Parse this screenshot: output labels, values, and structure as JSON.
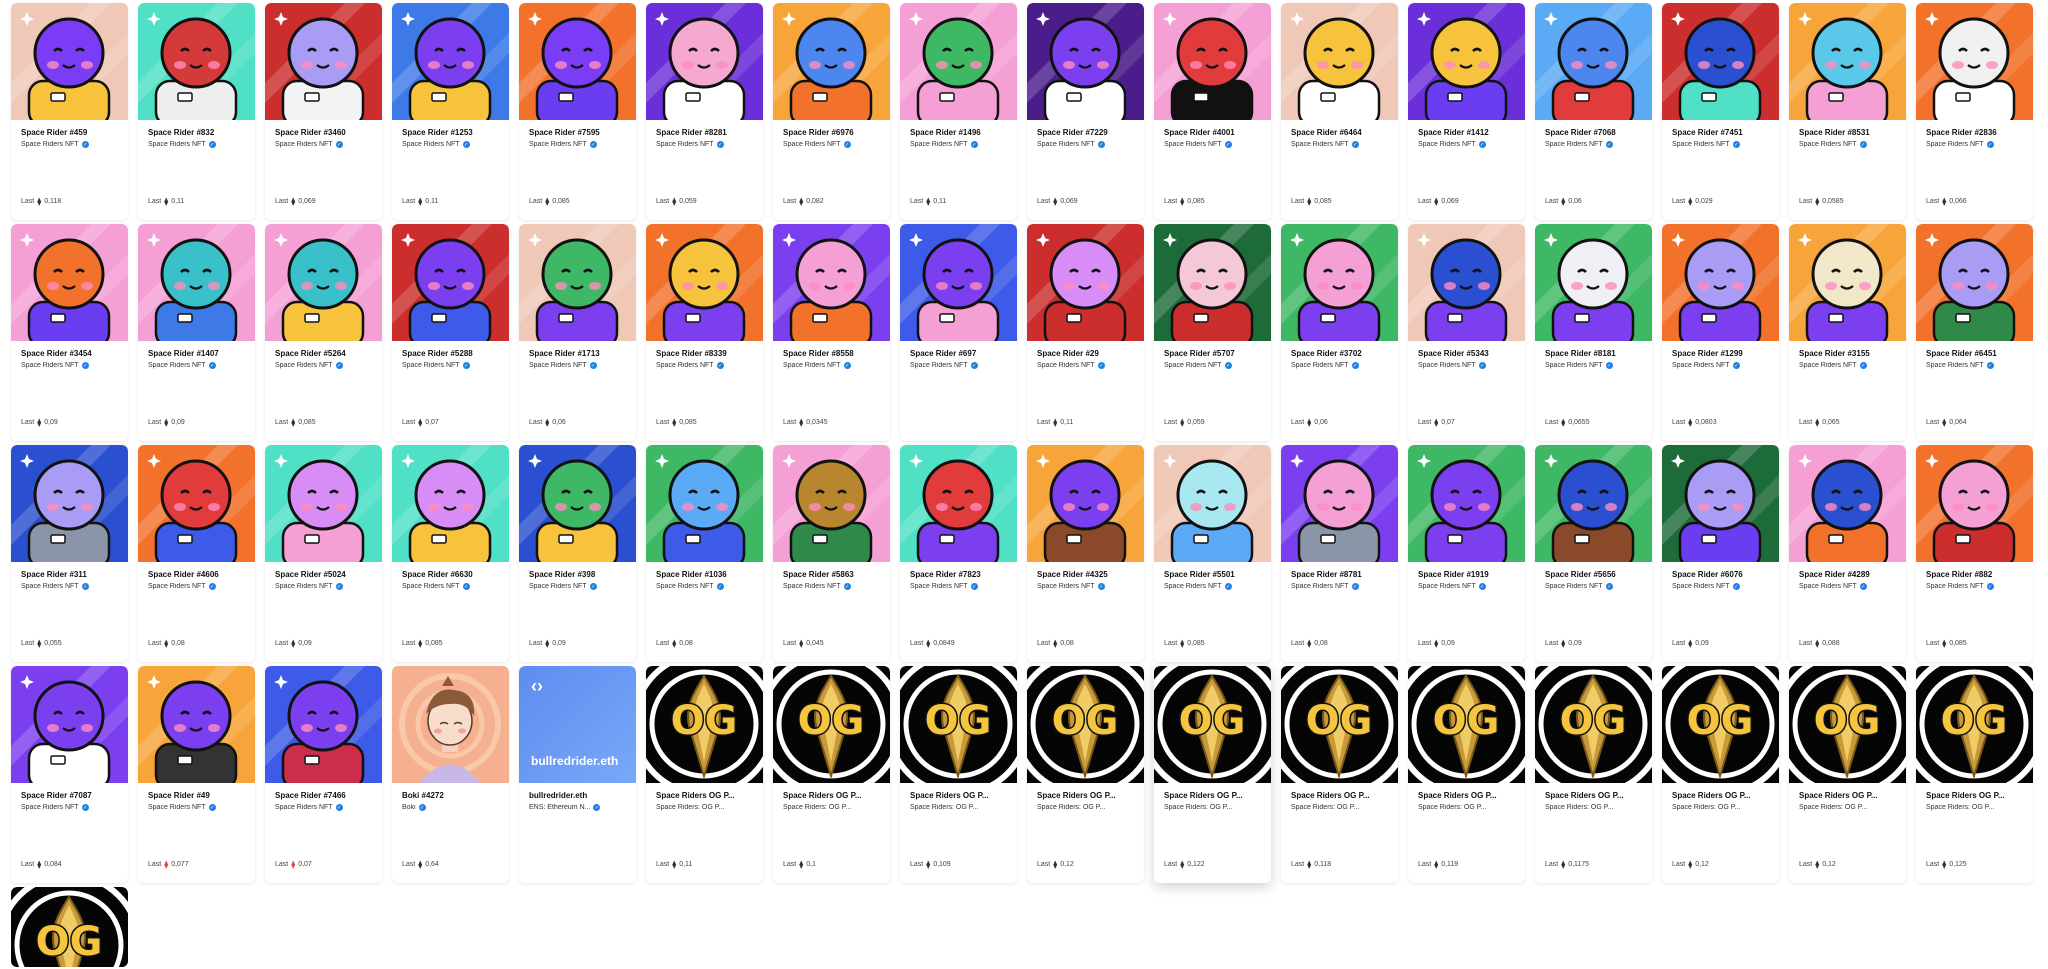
{
  "last_label": "Last",
  "eth_symbol": "⧫",
  "verified_symbol": "✓",
  "rows": [
    [
      {
        "name": "Space Rider #459",
        "collection": "Space Riders NFT",
        "verified": true,
        "price": "0,118",
        "bg": "#f0c8b8",
        "face": "#7a3df5",
        "suit": "#f7c33d",
        "icon": "rider-avatar"
      },
      {
        "name": "Space Rider #832",
        "collection": "Space Riders NFT",
        "verified": true,
        "price": "0,11",
        "bg": "#4fe0c5",
        "face": "#d43a3a",
        "suit": "#eeeeee",
        "icon": "rider-avatar"
      },
      {
        "name": "Space Rider #3460",
        "collection": "Space Riders NFT",
        "verified": true,
        "price": "0,069",
        "bg": "#cc2d2d",
        "face": "#a89cf5",
        "suit": "#f3f3f3",
        "icon": "rider-avatar"
      },
      {
        "name": "Space Rider #1253",
        "collection": "Space Riders NFT",
        "verified": true,
        "price": "0,11",
        "bg": "#3d7ae8",
        "face": "#7b3ff0",
        "suit": "#f7c33d",
        "icon": "rider-avatar"
      },
      {
        "name": "Space Rider #7595",
        "collection": "Space Riders NFT",
        "verified": true,
        "price": "0,085",
        "bg": "#f2722c",
        "face": "#7a3df5",
        "suit": "#6b3df0",
        "icon": "rider-avatar"
      },
      {
        "name": "Space Rider #8281",
        "collection": "Space Riders NFT",
        "verified": true,
        "price": "0,059",
        "bg": "#6a2fd8",
        "face": "#f5a8d0",
        "suit": "#ffffff",
        "icon": "rider-avatar"
      },
      {
        "name": "Space Rider #6976",
        "collection": "Space Riders NFT",
        "verified": true,
        "price": "0,082",
        "bg": "#f7a53a",
        "face": "#4e86f0",
        "suit": "#f2722c",
        "icon": "rider-avatar"
      },
      {
        "name": "Space Rider #1496",
        "collection": "Space Riders NFT",
        "verified": true,
        "price": "0,11",
        "bg": "#f5a0d5",
        "face": "#3fb866",
        "suit": "#f5a0d5",
        "icon": "rider-avatar"
      },
      {
        "name": "Space Rider #7229",
        "collection": "Space Riders NFT",
        "verified": true,
        "price": "0,069",
        "bg": "#4a1d8a",
        "face": "#7b3ff0",
        "suit": "#ffffff",
        "icon": "rider-avatar"
      },
      {
        "name": "Space Rider #4001",
        "collection": "Space Riders NFT",
        "verified": true,
        "price": "0,085",
        "bg": "#f5a0d5",
        "face": "#e23b3b",
        "suit": "#111111",
        "icon": "rider-avatar"
      },
      {
        "name": "Space Rider #6464",
        "collection": "Space Riders NFT",
        "verified": true,
        "price": "0,085",
        "bg": "#f0c8b8",
        "face": "#f7c33d",
        "suit": "#ffffff",
        "icon": "rider-avatar"
      },
      {
        "name": "Space Rider #1412",
        "collection": "Space Riders NFT",
        "verified": true,
        "price": "0,069",
        "bg": "#6a2fd8",
        "face": "#f7c33d",
        "suit": "#6b3df0",
        "icon": "rider-avatar"
      },
      {
        "name": "Space Rider #7068",
        "collection": "Space Riders NFT",
        "verified": true,
        "price": "0,06",
        "bg": "#5aaaf5",
        "face": "#4e86f0",
        "suit": "#e23b3b",
        "icon": "rider-avatar"
      },
      {
        "name": "Space Rider #7451",
        "collection": "Space Riders NFT",
        "verified": true,
        "price": "0,029",
        "bg": "#cc2d2d",
        "face": "#2a4fd0",
        "suit": "#4fe0c5",
        "icon": "rider-avatar"
      },
      {
        "name": "Space Rider #8531",
        "collection": "Space Riders NFT",
        "verified": true,
        "price": "0,0585",
        "bg": "#f7a53a",
        "face": "#5ac8e8",
        "suit": "#f5a0d5",
        "icon": "rider-avatar"
      },
      {
        "name": "Space Rider #2836",
        "collection": "Space Riders NFT",
        "verified": true,
        "price": "0,066",
        "bg": "#f2722c",
        "face": "#f0f0f0",
        "suit": "#ffffff",
        "icon": "rider-avatar"
      }
    ],
    [
      {
        "name": "Space Rider #3454",
        "collection": "Space Riders NFT",
        "verified": true,
        "price": "0,09",
        "bg": "#f5a0d5",
        "face": "#f2722c",
        "suit": "#6b3df0",
        "icon": "rider-avatar"
      },
      {
        "name": "Space Rider #1407",
        "collection": "Space Riders NFT",
        "verified": true,
        "price": "0,09",
        "bg": "#f5a0d5",
        "face": "#3ac0c8",
        "suit": "#3d7ae8",
        "icon": "rider-avatar"
      },
      {
        "name": "Space Rider #5264",
        "collection": "Space Riders NFT",
        "verified": true,
        "price": "0,085",
        "bg": "#f5a0d5",
        "face": "#3ac0c8",
        "suit": "#f7c33d",
        "icon": "rider-avatar"
      },
      {
        "name": "Space Rider #5288",
        "collection": "Space Riders NFT",
        "verified": true,
        "price": "0,07",
        "bg": "#cc2d2d",
        "face": "#7b3ff0",
        "suit": "#3d5ae8",
        "icon": "rider-avatar"
      },
      {
        "name": "Space Rider #1713",
        "collection": "Space Riders NFT",
        "verified": true,
        "price": "0,06",
        "bg": "#f0c8b8",
        "face": "#3fb866",
        "suit": "#7b3ff0",
        "icon": "rider-avatar"
      },
      {
        "name": "Space Rider #8339",
        "collection": "Space Riders NFT",
        "verified": true,
        "price": "0,085",
        "bg": "#f2722c",
        "face": "#f7c33d",
        "suit": "#7b3ff0",
        "icon": "rider-avatar"
      },
      {
        "name": "Space Rider #8558",
        "collection": "Space Riders NFT",
        "verified": true,
        "price": "0,0345",
        "bg": "#7b3ff0",
        "face": "#f5a0d5",
        "suit": "#f2722c",
        "icon": "rider-avatar"
      },
      {
        "name": "Space Rider #697",
        "collection": "Space Riders NFT",
        "verified": true,
        "price": "",
        "bg": "#3d5ae8",
        "face": "#7b3ff0",
        "suit": "#f5a0d5",
        "icon": "rider-avatar"
      },
      {
        "name": "Space Rider #29",
        "collection": "Space Riders NFT",
        "verified": true,
        "price": "0,11",
        "bg": "#cc2d2d",
        "face": "#d88cf5",
        "suit": "#cc2d2d",
        "icon": "rider-avatar"
      },
      {
        "name": "Space Rider #5707",
        "collection": "Space Riders NFT",
        "verified": true,
        "price": "0,059",
        "bg": "#1e6b3a",
        "face": "#f5c8d8",
        "suit": "#cc2d2d",
        "icon": "rider-avatar"
      },
      {
        "name": "Space Rider #3702",
        "collection": "Space Riders NFT",
        "verified": true,
        "price": "0,06",
        "bg": "#3fb866",
        "face": "#f5a0d5",
        "suit": "#7b3ff0",
        "icon": "rider-avatar"
      },
      {
        "name": "Space Rider #5343",
        "collection": "Space Riders NFT",
        "verified": true,
        "price": "0,07",
        "bg": "#f0c8b8",
        "face": "#2a4fd0",
        "suit": "#7b3ff0",
        "icon": "rider-avatar"
      },
      {
        "name": "Space Rider #8181",
        "collection": "Space Riders NFT",
        "verified": true,
        "price": "0,0655",
        "bg": "#3fb866",
        "face": "#eef0f5",
        "suit": "#7b3ff0",
        "icon": "rider-avatar"
      },
      {
        "name": "Space Rider #1299",
        "collection": "Space Riders NFT",
        "verified": true,
        "price": "0,0803",
        "bg": "#f2722c",
        "face": "#a89cf5",
        "suit": "#7b3ff0",
        "icon": "rider-avatar"
      },
      {
        "name": "Space Rider #3155",
        "collection": "Space Riders NFT",
        "verified": true,
        "price": "0,065",
        "bg": "#f7a53a",
        "face": "#f0e8c8",
        "suit": "#7b3ff0",
        "icon": "rider-avatar"
      },
      {
        "name": "Space Rider #6451",
        "collection": "Space Riders NFT",
        "verified": true,
        "price": "0,064",
        "bg": "#f2722c",
        "face": "#a89cf5",
        "suit": "#2f8a4a",
        "icon": "rider-avatar"
      }
    ],
    [
      {
        "name": "Space Rider #311",
        "collection": "Space Riders NFT",
        "verified": true,
        "price": "0,055",
        "bg": "#2a4fd0",
        "face": "#a89cf5",
        "suit": "#8a96a8",
        "icon": "rider-avatar"
      },
      {
        "name": "Space Rider #4606",
        "collection": "Space Riders NFT",
        "verified": true,
        "price": "0,08",
        "bg": "#f2722c",
        "face": "#e23b3b",
        "suit": "#3d5ae8",
        "icon": "rider-avatar"
      },
      {
        "name": "Space Rider #5024",
        "collection": "Space Riders NFT",
        "verified": true,
        "price": "0,09",
        "bg": "#4fe0c5",
        "face": "#d88cf5",
        "suit": "#f5a0d5",
        "icon": "rider-avatar"
      },
      {
        "name": "Space Rider #6630",
        "collection": "Space Riders NFT",
        "verified": true,
        "price": "0,085",
        "bg": "#4fe0c5",
        "face": "#d88cf5",
        "suit": "#f7c33d",
        "icon": "rider-avatar"
      },
      {
        "name": "Space Rider #398",
        "collection": "Space Riders NFT",
        "verified": true,
        "price": "0,09",
        "bg": "#2a4fd0",
        "face": "#3fb866",
        "suit": "#f7c33d",
        "icon": "rider-avatar"
      },
      {
        "name": "Space Rider #1036",
        "collection": "Space Riders NFT",
        "verified": true,
        "price": "0,08",
        "bg": "#3fb866",
        "face": "#5aaaf5",
        "suit": "#3d5ae8",
        "icon": "rider-avatar"
      },
      {
        "name": "Space Rider #5863",
        "collection": "Space Riders NFT",
        "verified": true,
        "price": "0,045",
        "bg": "#f5a0d5",
        "face": "#b8862e",
        "suit": "#2f8a4a",
        "icon": "rider-avatar"
      },
      {
        "name": "Space Rider #7823",
        "collection": "Space Riders NFT",
        "verified": true,
        "price": "0,0849",
        "bg": "#4fe0c5",
        "face": "#e23b3b",
        "suit": "#7b3ff0",
        "icon": "rider-avatar"
      },
      {
        "name": "Space Rider #4325",
        "collection": "Space Riders NFT",
        "verified": true,
        "price": "0,08",
        "bg": "#f7a53a",
        "face": "#7b3ff0",
        "suit": "#8a4a2a",
        "icon": "rider-avatar"
      },
      {
        "name": "Space Rider #5501",
        "collection": "Space Riders NFT",
        "verified": true,
        "price": "0,085",
        "bg": "#f0c8b8",
        "face": "#a8e8f0",
        "suit": "#5aaaf5",
        "icon": "rider-avatar"
      },
      {
        "name": "Space Rider #8781",
        "collection": "Space Riders NFT",
        "verified": true,
        "price": "0,08",
        "bg": "#7b3ff0",
        "face": "#f5a0d5",
        "suit": "#8a96a8",
        "icon": "rider-avatar"
      },
      {
        "name": "Space Rider #1919",
        "collection": "Space Riders NFT",
        "verified": true,
        "price": "0,09",
        "bg": "#3fb866",
        "face": "#7b3ff0",
        "suit": "#7b3ff0",
        "icon": "rider-avatar"
      },
      {
        "name": "Space Rider #5656",
        "collection": "Space Riders NFT",
        "verified": true,
        "price": "0,09",
        "bg": "#3fb866",
        "face": "#2a4fd0",
        "suit": "#8a4a2a",
        "icon": "rider-avatar"
      },
      {
        "name": "Space Rider #6076",
        "collection": "Space Riders NFT",
        "verified": true,
        "price": "0,09",
        "bg": "#1e6b3a",
        "face": "#a89cf5",
        "suit": "#6b3df0",
        "icon": "rider-avatar"
      },
      {
        "name": "Space Rider #4289",
        "collection": "Space Riders NFT",
        "verified": true,
        "price": "0,088",
        "bg": "#f5a0d5",
        "face": "#2a4fd0",
        "suit": "#f2722c",
        "icon": "rider-avatar"
      },
      {
        "name": "Space Rider #882",
        "collection": "Space Riders NFT",
        "verified": true,
        "price": "0,085",
        "bg": "#f2722c",
        "face": "#f5a0d5",
        "suit": "#cc2d2d",
        "icon": "rider-avatar"
      }
    ],
    [
      {
        "name": "Space Rider #7087",
        "collection": "Space Riders NFT",
        "verified": true,
        "price": "0,084",
        "bg": "#7b3ff0",
        "face": "#7b3ff0",
        "suit": "#ffffff",
        "icon": "rider-avatar"
      },
      {
        "name": "Space Rider #49",
        "collection": "Space Riders NFT",
        "verified": true,
        "price": "0,077",
        "priceRed": true,
        "bg": "#f7a53a",
        "face": "#7b3ff0",
        "suit": "#333333",
        "icon": "rider-avatar"
      },
      {
        "name": "Space Rider #7466",
        "collection": "Space Riders NFT",
        "verified": true,
        "price": "0,07",
        "priceRed": true,
        "bg": "#3d5ae8",
        "face": "#7b3ff0",
        "suit": "#cc2d4a",
        "icon": "rider-avatar"
      },
      {
        "name": "Boki #4272",
        "collection": "Boki",
        "verified": true,
        "price": "0,64",
        "kind": "boki",
        "bg": "#f5b090",
        "icon": "boki-avatar"
      },
      {
        "name": "bullredrider.eth",
        "collection": "ENS: Ethereum N...",
        "verified": true,
        "price": "",
        "kind": "ens",
        "ens_logo": "‹›",
        "ens_text": "bullredrider.eth",
        "icon": "ens-logo"
      },
      {
        "name": "Space Riders OG P...",
        "collection": "Space Riders: OG P...",
        "verified": false,
        "price": "0,11",
        "kind": "og",
        "og_text": "OG",
        "icon": "og-badge"
      },
      {
        "name": "Space Riders OG P...",
        "collection": "Space Riders: OG P...",
        "verified": false,
        "price": "0,1",
        "kind": "og",
        "og_text": "OG",
        "icon": "og-badge"
      },
      {
        "name": "Space Riders OG P...",
        "collection": "Space Riders: OG P...",
        "verified": false,
        "price": "0,109",
        "kind": "og",
        "og_text": "OG",
        "icon": "og-badge"
      },
      {
        "name": "Space Riders OG P...",
        "collection": "Space Riders: OG P...",
        "verified": false,
        "price": "0,12",
        "kind": "og",
        "og_text": "OG",
        "icon": "og-badge"
      },
      {
        "name": "Space Riders OG P...",
        "collection": "Space Riders: OG P...",
        "verified": false,
        "price": "0,122",
        "kind": "og",
        "og_text": "OG",
        "hover": true,
        "icon": "og-badge"
      },
      {
        "name": "Space Riders OG P...",
        "collection": "Space Riders: OG P...",
        "verified": false,
        "price": "0,118",
        "kind": "og",
        "og_text": "OG",
        "icon": "og-badge"
      },
      {
        "name": "Space Riders OG P...",
        "collection": "Space Riders: OG P...",
        "verified": false,
        "price": "0,119",
        "kind": "og",
        "og_text": "OG",
        "icon": "og-badge"
      },
      {
        "name": "Space Riders OG P...",
        "collection": "Space Riders: OG P...",
        "verified": false,
        "price": "0,1175",
        "kind": "og",
        "og_text": "OG",
        "icon": "og-badge"
      },
      {
        "name": "Space Riders OG P...",
        "collection": "Space Riders: OG P...",
        "verified": false,
        "price": "0,12",
        "kind": "og",
        "og_text": "OG",
        "icon": "og-badge"
      },
      {
        "name": "Space Riders OG P...",
        "collection": "Space Riders: OG P...",
        "verified": false,
        "price": "0,12",
        "kind": "og",
        "og_text": "OG",
        "icon": "og-badge"
      },
      {
        "name": "Space Riders OG P...",
        "collection": "Space Riders: OG P...",
        "verified": false,
        "price": "0,125",
        "kind": "og",
        "og_text": "OG",
        "icon": "og-badge"
      }
    ],
    [
      {
        "name": "",
        "collection": "",
        "verified": false,
        "price": "",
        "kind": "og",
        "og_text": "OG",
        "partial": true,
        "icon": "og-badge"
      }
    ]
  ]
}
